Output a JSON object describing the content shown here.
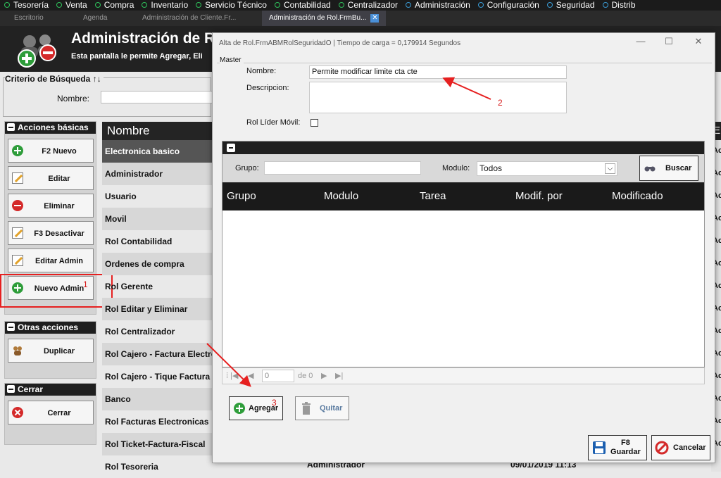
{
  "menu": [
    {
      "label": "Tesorería",
      "color": "green"
    },
    {
      "label": "Venta",
      "color": "green"
    },
    {
      "label": "Compra",
      "color": "green"
    },
    {
      "label": "Inventario",
      "color": "green"
    },
    {
      "label": "Servicio Técnico",
      "color": "green"
    },
    {
      "label": "Contabilidad",
      "color": "green"
    },
    {
      "label": "Centralizador",
      "color": "green"
    },
    {
      "label": "Administración",
      "color": "blue"
    },
    {
      "label": "Configuración",
      "color": "blue"
    },
    {
      "label": "Seguridad",
      "color": "blue"
    },
    {
      "label": "Distrib",
      "color": "blue"
    }
  ],
  "tabs": {
    "t1": "Escritorio",
    "t2": "Agenda",
    "t3": "Administración de Cliente.Fr...",
    "active": "Administración de Rol.FrmBu...",
    "close": "✕"
  },
  "header": {
    "title": "Administración de Ro",
    "subtitle": "Esta pantalla le permite Agregar, Eli"
  },
  "criteria": {
    "legend": "Criterio de Búsqueda ↑↓",
    "nombre_label": "Nombre:"
  },
  "panels": {
    "basic": {
      "title": "Acciones básicas",
      "buttons": [
        "F2 Nuevo",
        "Editar",
        "Eliminar",
        "F3 Desactivar",
        "Editar Admin",
        "Nuevo Admin"
      ]
    },
    "other": {
      "title": "Otras acciones",
      "buttons": [
        "Duplicar"
      ]
    },
    "close": {
      "title": "Cerrar",
      "buttons": [
        "Cerrar"
      ]
    }
  },
  "grid": {
    "header": "Nombre",
    "rows": [
      "Electronica basico",
      "Administrador",
      "Usuario",
      "Movil",
      "Rol Contabilidad",
      "Ordenes de compra",
      "Rol Gerente",
      "Rol Editar y Eliminar",
      "Rol Centralizador",
      "Rol Cajero - Factura Electronica",
      "Rol Cajero - Tique Factura",
      "Banco",
      "Rol Facturas Electronicas",
      "Rol Ticket-Factura-Fiscal",
      "Rol Tesoreria"
    ],
    "right_header": "E",
    "right_cell": "Ac",
    "last_row_user": "Administrador",
    "last_row_date": "09/01/2019 11:13"
  },
  "dialog": {
    "caption": "Alta de Rol.FrmABMRolSeguridadO | Tiempo de carga = 0,179914 Segundos",
    "window_controls": {
      "minimize": "—",
      "maximize": "☐",
      "close": "✕"
    },
    "master": {
      "legend": "Master",
      "nombre_label": "Nombre:",
      "nombre_value": "Permite modificar limite cta cte",
      "descripcion_label": "Descripcion:",
      "descripcion_value": "",
      "rol_lider_label": "Rol Líder Móvil:"
    },
    "detail": {
      "grupo_label": "Grupo:",
      "grupo_value": "",
      "modulo_label": "Modulo:",
      "modulo_value": "Todos",
      "buscar": "Buscar",
      "columns": [
        "Grupo",
        "Modulo",
        "Tarea",
        "Modif. por",
        "Modificado"
      ]
    },
    "nav": {
      "page": "0",
      "of": "de 0"
    },
    "agregar": "Agregar",
    "quitar": "Quitar",
    "guardar_key": "F8",
    "guardar": "Guardar",
    "cancelar": "Cancelar"
  },
  "annotations": {
    "n1": "1",
    "n2": "2",
    "n3": "3"
  }
}
